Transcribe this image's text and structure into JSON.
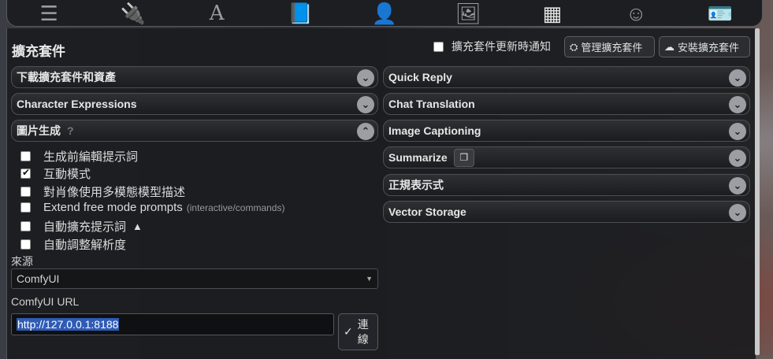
{
  "toolbar": {
    "icons": [
      "sliders-icon",
      "plug-icon",
      "font-icon",
      "book-icon",
      "user-gear-icon",
      "image-icon",
      "cubes-icon",
      "smile-icon",
      "id-card-icon"
    ]
  },
  "header": {
    "title": "擴充套件",
    "notify_label": "擴充套件更新時通知",
    "manage_label": "管理擴充套件",
    "install_label": "安裝擴充套件"
  },
  "left": {
    "download": "下載擴充套件和資產",
    "expressions": "Character Expressions",
    "image_gen": "圖片生成",
    "help": "?",
    "options": [
      {
        "label": "生成前編輯提示詞",
        "checked": false
      },
      {
        "label": "互動模式",
        "checked": true
      },
      {
        "label": "對肖像使用多模態模型描述",
        "checked": false
      },
      {
        "label": "Extend free mode prompts",
        "checked": false,
        "hint": "(interactive/commands)"
      },
      {
        "label": "自動擴充提示詞",
        "checked": false
      },
      {
        "label": "自動調整解析度",
        "checked": false
      }
    ],
    "source_label": "來源",
    "source_value": "ComfyUI",
    "url_label": "ComfyUI URL",
    "url_value": "http://127.0.0.1:8188",
    "connect_label": "連線"
  },
  "right": {
    "items": [
      "Quick Reply",
      "Chat Translation",
      "Image Captioning",
      "Summarize",
      "正規表示式",
      "Vector Storage"
    ]
  }
}
